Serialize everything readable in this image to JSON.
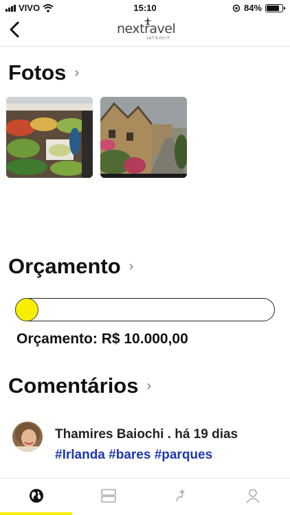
{
  "status_bar": {
    "carrier": "VIVO",
    "time": "15:10",
    "battery": "84%",
    "battery_level": 0.84
  },
  "nav": {
    "back_icon": "chevron-left-icon",
    "logo_text": "nextravel",
    "logo_tagline": "LET'S DO IT"
  },
  "photos": {
    "title": "Fotos",
    "chevron": "›",
    "items": [
      {
        "name": "market-photo"
      },
      {
        "name": "village-photo"
      }
    ]
  },
  "budget": {
    "title": "Orçamento",
    "chevron": "›",
    "slider_level": 0.0,
    "label": "Orçamento: R$ 10.000,00",
    "thumb_color": "#f7ee00"
  },
  "comments": {
    "title": "Comentários",
    "chevron": "›",
    "items": [
      {
        "line": "Thamires Baiochi . há 19 dias",
        "tags": "#Irlanda #bares #parques"
      }
    ]
  },
  "tabs": [
    {
      "icon": "globe-icon",
      "active": true
    },
    {
      "icon": "list-icon",
      "active": false
    },
    {
      "icon": "route-icon",
      "active": false
    },
    {
      "icon": "profile-icon",
      "active": false
    }
  ],
  "colors": {
    "accent": "#f7ee00",
    "hashtag": "#1f37b3"
  }
}
